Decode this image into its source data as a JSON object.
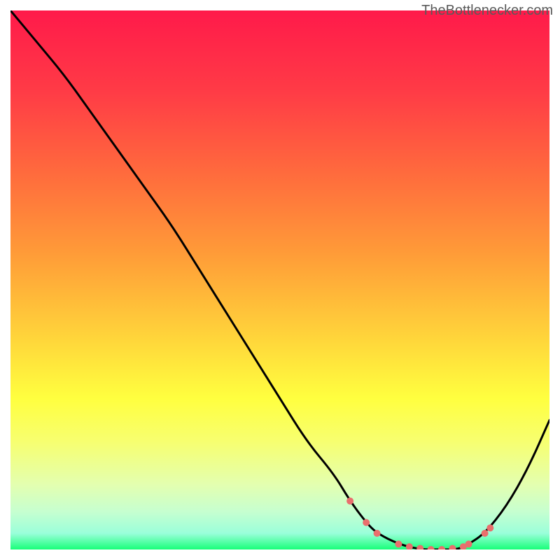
{
  "watermark": "TheBottlenecker.com",
  "gradient": {
    "stops": [
      {
        "offset": 0.0,
        "color": "#ff1a4a"
      },
      {
        "offset": 0.15,
        "color": "#ff3b46"
      },
      {
        "offset": 0.3,
        "color": "#ff6a3d"
      },
      {
        "offset": 0.45,
        "color": "#ff9b38"
      },
      {
        "offset": 0.6,
        "color": "#ffd23a"
      },
      {
        "offset": 0.72,
        "color": "#ffff3f"
      },
      {
        "offset": 0.8,
        "color": "#f7ff70"
      },
      {
        "offset": 0.88,
        "color": "#e3ffb0"
      },
      {
        "offset": 0.93,
        "color": "#c6ffd0"
      },
      {
        "offset": 0.97,
        "color": "#9affda"
      },
      {
        "offset": 1.0,
        "color": "#19ff7a"
      }
    ]
  },
  "curve": {
    "color": "#000000",
    "width": 3,
    "dot_color": "#e96e6d",
    "dot_radius_small": 5,
    "dot_radius_large": 8
  },
  "chart_data": {
    "type": "line",
    "title": "",
    "xlabel": "",
    "ylabel": "",
    "xlim": [
      0,
      100
    ],
    "ylim": [
      0,
      100
    ],
    "x": [
      0,
      5,
      10,
      15,
      20,
      25,
      30,
      35,
      40,
      45,
      50,
      55,
      60,
      63,
      66,
      68,
      72,
      76,
      80,
      83,
      85,
      88,
      92,
      96,
      100
    ],
    "y": [
      100,
      94,
      88,
      81,
      74,
      67,
      60,
      52,
      44,
      36,
      28,
      20,
      14,
      9,
      5,
      3,
      1,
      0,
      0,
      0,
      1,
      3,
      8,
      15,
      24
    ],
    "marker_points": [
      {
        "x": 63,
        "y": 9,
        "size": "small"
      },
      {
        "x": 66,
        "y": 5,
        "size": "small"
      },
      {
        "x": 68,
        "y": 3,
        "size": "small"
      },
      {
        "x": 72,
        "y": 1,
        "size": "small"
      },
      {
        "x": 74,
        "y": 0.5,
        "size": "small"
      },
      {
        "x": 76,
        "y": 0.2,
        "size": "small"
      },
      {
        "x": 78,
        "y": 0,
        "size": "small"
      },
      {
        "x": 80,
        "y": 0,
        "size": "small"
      },
      {
        "x": 82,
        "y": 0.2,
        "size": "small"
      },
      {
        "x": 84,
        "y": 0.5,
        "size": "small"
      },
      {
        "x": 85,
        "y": 1,
        "size": "small"
      },
      {
        "x": 88,
        "y": 3,
        "size": "small"
      },
      {
        "x": 89,
        "y": 4,
        "size": "small"
      }
    ]
  }
}
